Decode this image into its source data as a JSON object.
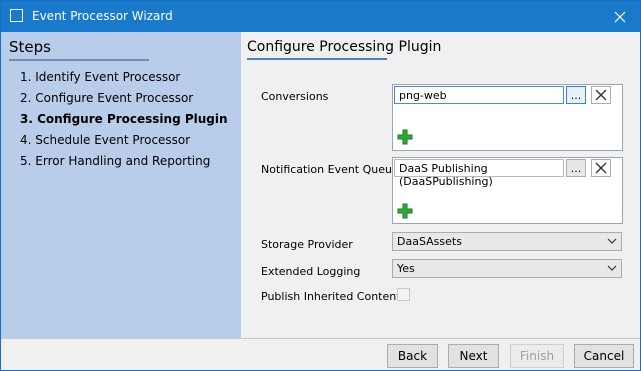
{
  "window": {
    "title": "Event Processor Wizard"
  },
  "steps": {
    "title": "Steps",
    "items": [
      {
        "label": "1. Identify Event Processor"
      },
      {
        "label": "2. Configure Event Processor"
      },
      {
        "label": "3. Configure Processing Plugin"
      },
      {
        "label": "4. Schedule Event Processor"
      },
      {
        "label": "5. Error Handling and Reporting"
      }
    ],
    "active_index": 2
  },
  "content": {
    "title": "Configure Processing Plugin",
    "conversions": {
      "label": "Conversions",
      "value": "png-web",
      "browse_label": "..."
    },
    "notification": {
      "label": "Notification Event Queues",
      "value": "DaaS Publishing (DaaSPublishing)",
      "browse_label": "..."
    },
    "storage": {
      "label": "Storage Provider",
      "value": "DaaSAssets"
    },
    "logging": {
      "label": "Extended Logging",
      "value": "Yes"
    },
    "inherited": {
      "label": "Publish Inherited Content",
      "checked": false
    }
  },
  "footer": {
    "back": "Back",
    "next": "Next",
    "finish": "Finish",
    "cancel": "Cancel"
  },
  "colors": {
    "titlebar": "#1979ca",
    "steps_panel": "#b8cde9",
    "plus_green": "#2fa93a"
  }
}
